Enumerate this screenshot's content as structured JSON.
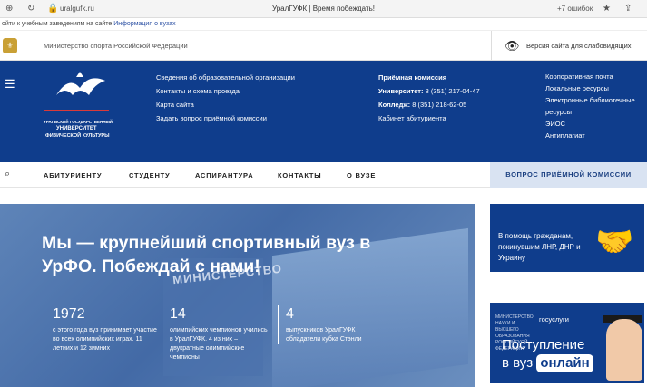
{
  "browser": {
    "url": "uralgufk.ru",
    "tab_title": "УралГУФК | Время побеждать!",
    "extensions_label": "+7 ошибок"
  },
  "notice_strip": {
    "text": "ойти к учебным заведениям на сайте",
    "link": "Информация о вузах"
  },
  "gov_bar": {
    "ministry": "Министерство спорта Российской Федерации",
    "vision_link": "Версия сайта для слабовидящих"
  },
  "logo": {
    "line1": "УРАЛЬСКИЙ ГОСУДАРСТВЕННЫЙ",
    "line2": "УНИВЕРСИТЕТ",
    "line3": "ФИЗИЧЕСКОЙ КУЛЬТУРЫ"
  },
  "header_links_col1": [
    "Сведения об образовательной организации",
    "Контакты и схема проезда",
    "Карта сайта",
    "Задать вопрос приёмной комиссии"
  ],
  "admission": {
    "title": "Приёмная комиссия",
    "university_label": "Университет:",
    "university_phone": "8 (351) 217-04-47",
    "college_label": "Колледж:",
    "college_phone": "8 (351) 218-62-05",
    "cabinet": "Кабинет абитуриента"
  },
  "header_links_col3": [
    "Корпоративная почта",
    "Локальные ресурсы",
    "Электронные библиотечные",
    "ресурсы",
    "ЭИОС",
    "Антиплагиат"
  ],
  "nav": {
    "items": [
      "АБИТУРИЕНТУ",
      "СТУДЕНТУ",
      "АСПИРАНТУРА",
      "КОНТАКТЫ",
      "О ВУЗЕ"
    ],
    "ask_button": "ВОПРОС ПРИЁМНОЙ КОМИССИИ"
  },
  "hero": {
    "headline": "Мы — крупнейший спортивный вуз в УрФО. Побеждай с нами!",
    "background_sign": "МИНИСТЕРСТВО",
    "stats": [
      {
        "number": "1972",
        "text": "с этого года вуз принимает участие во всех олимпийских играх. 11 летних и 12 зимних"
      },
      {
        "number": "14",
        "text": "олимпийских чемпионов учились в УралГУФК. 4 из них – двукратные олимпийские чемпионы"
      },
      {
        "number": "4",
        "text": "выпускников УралГУФК обладатели кубка Стэнли"
      }
    ]
  },
  "side_cards": {
    "help": "В помощь гражданам, покинувшим ЛНР, ДНР и Украину",
    "gosuslugi_ministry": "МИНИСТЕРСТВО НАУКИ И ВЫСШЕГО ОБРАЗОВАНИЯ РОССИЙСКОЙ ФЕДЕРАЦИИ",
    "gosuslugi_brand": "госуслуги",
    "admission_line1": "Поступление",
    "admission_line2": "в вуз",
    "admission_pill": "онлайн"
  },
  "colors": {
    "brand_blue": "#0f3d8c",
    "nav_ask_bg": "#d9e3f2",
    "logo_red": "#d93a3a"
  }
}
